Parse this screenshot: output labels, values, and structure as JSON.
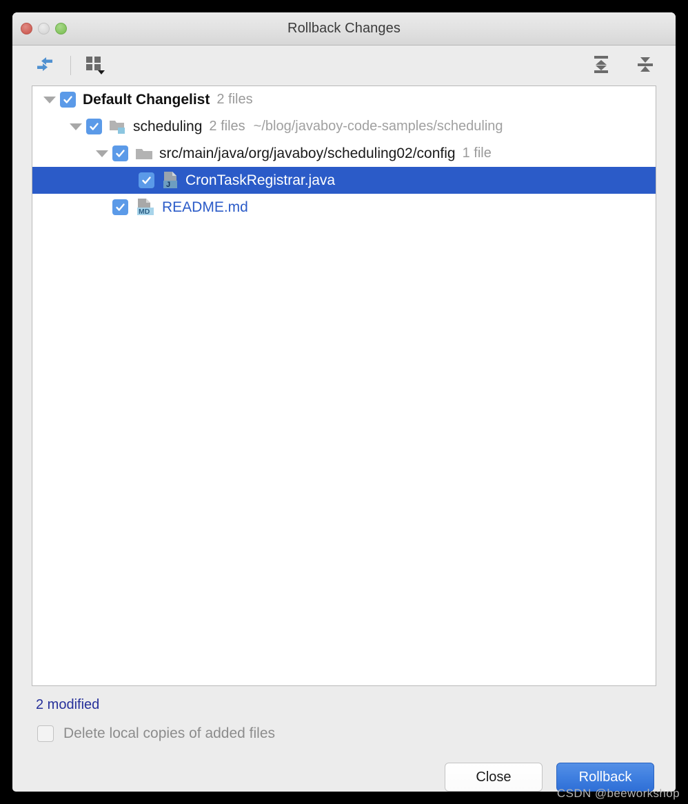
{
  "window": {
    "title": "Rollback Changes",
    "traffic_lights": [
      "close",
      "minimize",
      "maximize"
    ]
  },
  "toolbar": {
    "left": [
      {
        "name": "show-diff-icon",
        "label": "Show Diff"
      },
      {
        "name": "group-by-icon",
        "label": "Group By"
      }
    ],
    "right": [
      {
        "name": "expand-all-icon",
        "label": "Expand All"
      },
      {
        "name": "collapse-all-icon",
        "label": "Collapse All"
      }
    ]
  },
  "tree": {
    "rows": [
      {
        "name": "Default Changelist",
        "meta": "2 files",
        "path": "",
        "checked": true,
        "expanded": true,
        "depth": 0,
        "icon": "none",
        "selected": false,
        "bold": true,
        "color": "default"
      },
      {
        "name": "scheduling",
        "meta": "2 files",
        "path": "~/blog/javaboy-code-samples/scheduling",
        "checked": true,
        "expanded": true,
        "depth": 1,
        "icon": "module-folder-icon",
        "selected": false,
        "bold": false,
        "color": "default"
      },
      {
        "name": "src/main/java/org/javaboy/scheduling02/config",
        "meta": "1 file",
        "path": "",
        "checked": true,
        "expanded": true,
        "depth": 2,
        "icon": "folder-icon",
        "selected": false,
        "bold": false,
        "color": "default"
      },
      {
        "name": "CronTaskRegistrar.java",
        "meta": "",
        "path": "",
        "checked": true,
        "expanded": null,
        "depth": 3,
        "icon": "java-file-icon",
        "selected": true,
        "bold": false,
        "color": "default"
      },
      {
        "name": "README.md",
        "meta": "",
        "path": "",
        "checked": true,
        "expanded": null,
        "depth": 2,
        "icon": "markdown-file-icon",
        "selected": false,
        "bold": false,
        "color": "blue"
      }
    ]
  },
  "status": {
    "modified_text": "2 modified"
  },
  "options": {
    "delete_local_copies_label": "Delete local copies of added files",
    "delete_local_copies_checked": false
  },
  "buttons": {
    "close_label": "Close",
    "rollback_label": "Rollback"
  },
  "watermark": "CSDN @beeworkshop",
  "colors": {
    "selection_blue": "#2b5bc8",
    "checkbox_blue": "#5b9ae8",
    "modified_text": "#26309a",
    "primary_button": "#3f7fe0",
    "link_blue": "#2b5bc8"
  }
}
